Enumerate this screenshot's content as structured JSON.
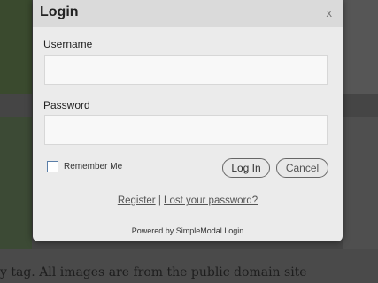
{
  "background": {
    "text": "y tag.  All images are from the public domain site"
  },
  "modal": {
    "title": "Login",
    "close_label": "x",
    "username_label": "Username",
    "username_value": "",
    "password_label": "Password",
    "password_value": "",
    "remember_label": "Remember Me",
    "login_button": "Log In",
    "cancel_button": "Cancel",
    "register_link": "Register",
    "separator": "|",
    "lost_password_link": "Lost your password?",
    "powered_by": "Powered by SimpleModal Login"
  }
}
